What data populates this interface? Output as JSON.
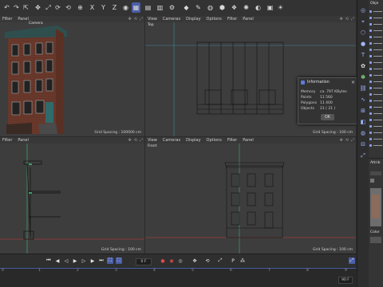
{
  "toolbar": {
    "icons": [
      "undo-icon",
      "redo-icon",
      "select-icon",
      "move-icon",
      "scale-icon",
      "rotate-icon",
      "recent-icon",
      "x-axis",
      "y-axis",
      "z-axis",
      "world-coords",
      "render-active",
      "render-view",
      "render-settings",
      "cube-icon",
      "pen-icon",
      "subdivision-icon",
      "extrude-icon",
      "cloner-icon",
      "deformer-icon",
      "field-icon",
      "camera-icon",
      "light-icon"
    ],
    "axis_x": "X",
    "axis_y": "Y",
    "axis_z": "Z"
  },
  "viewports": {
    "perspective": {
      "menu": [
        "Filter",
        "Panel"
      ],
      "name": "Camera",
      "grid": "Grid Spacing : 100000 cm"
    },
    "top": {
      "menu": [
        "View",
        "Cameras",
        "Display",
        "Options",
        "Filter",
        "Panel"
      ],
      "name": "Top",
      "grid": "Grid Spacing : 100 cm"
    },
    "right": {
      "menu": [
        "Filter",
        "Panel"
      ],
      "grid": "Grid Spacing : 100 cm"
    },
    "front": {
      "menu": [
        "View",
        "Cameras",
        "Display",
        "Options",
        "Filter",
        "Panel"
      ],
      "name": "Front",
      "grid": "Grid Spacing : 100 cm"
    }
  },
  "dialog": {
    "title": "Information",
    "rows": [
      {
        "label": "Memory",
        "value": "ca. 797 KBytes"
      },
      {
        "label": "Points",
        "value": "11 560"
      },
      {
        "label": "Polygons",
        "value": "11 400"
      },
      {
        "label": "Objects",
        "value": "21 ( 21 )"
      }
    ],
    "ok_label": "OK"
  },
  "timeline": {
    "current_frame": "0 F",
    "end_frame": "90 F"
  },
  "ruler": {
    "ticks": [
      "0",
      "1",
      "2",
      "3",
      "4",
      "5",
      "6",
      "7",
      "8",
      "9"
    ]
  },
  "object_panel": {
    "header": "Obje",
    "attr_header": "Attrib",
    "color_label": "Color"
  },
  "colors": {
    "accent": "#4b5ea8",
    "selection": "#5d7bd8",
    "viewport_bg": "#3d3d3d"
  }
}
